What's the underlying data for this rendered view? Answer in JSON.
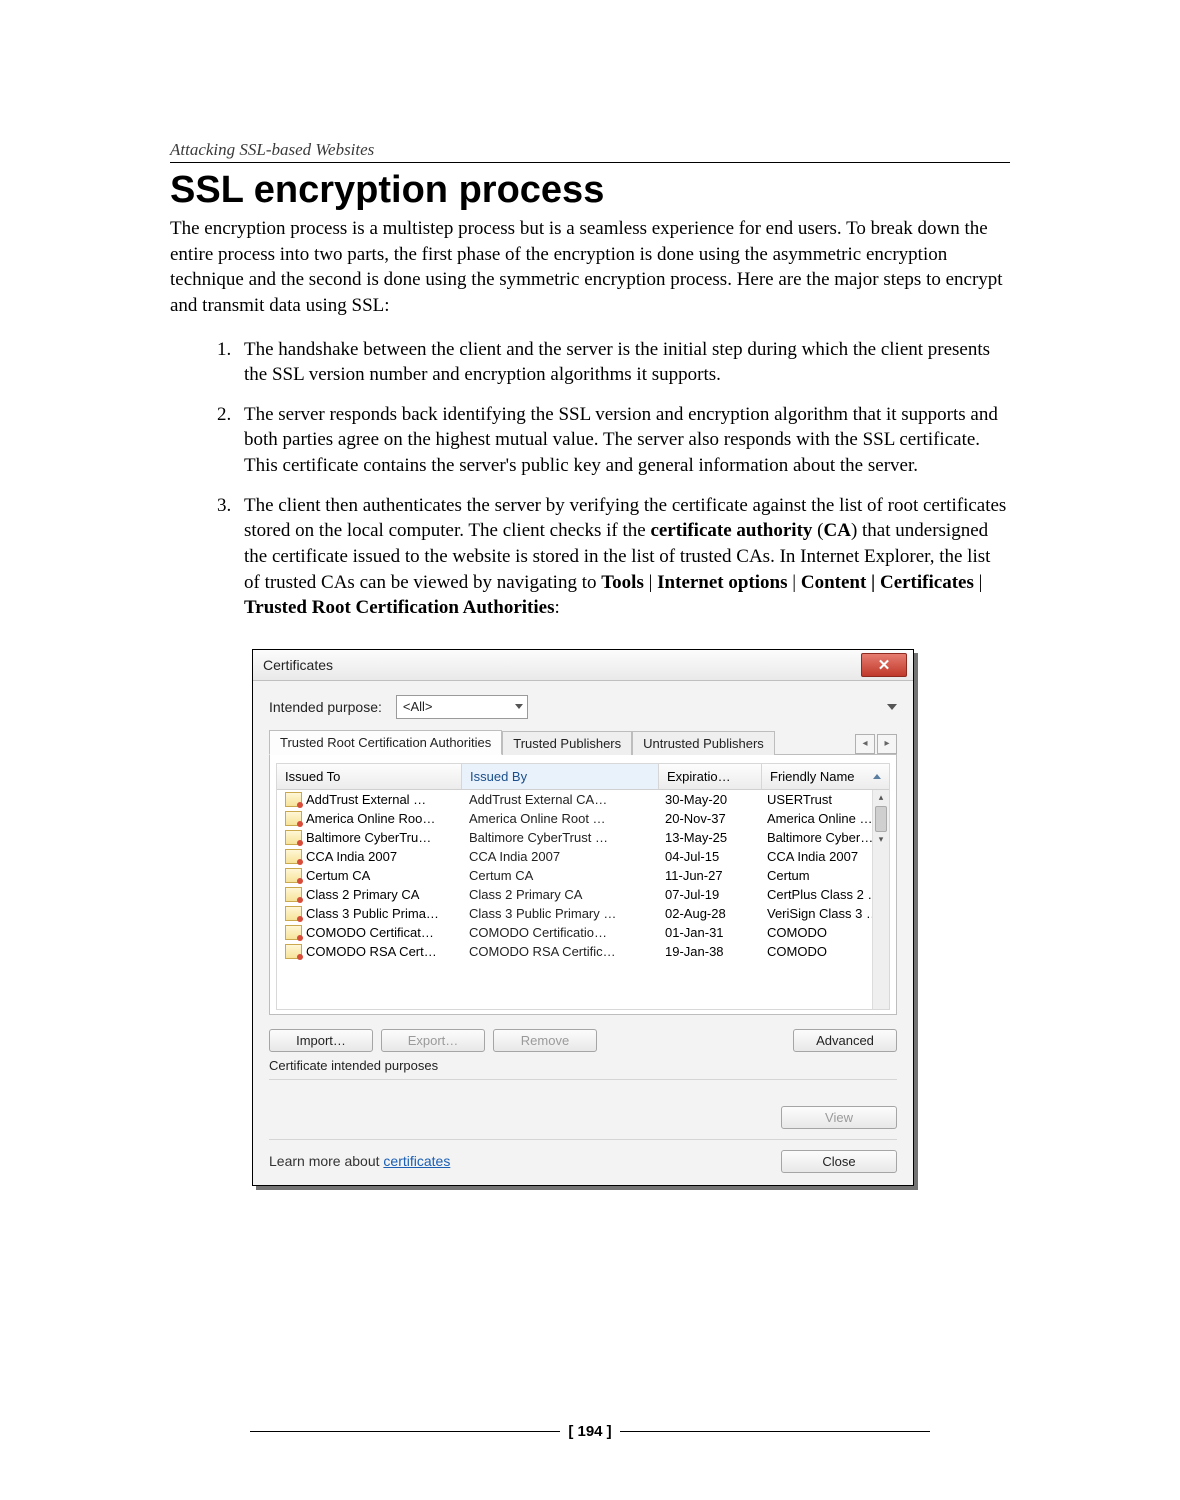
{
  "page": {
    "running_head": "Attacking SSL-based Websites",
    "title": "SSL encryption process",
    "intro": "The encryption process is a multistep process but is a seamless experience for end users. To break down the entire process into two parts, the first phase of the encryption is done using the asymmetric encryption technique and the second is done using the symmetric encryption process. Here are the major steps to encrypt and transmit data using SSL:",
    "steps": {
      "s1": "The handshake between the client and the server is the initial step during which the client presents the SSL version number and encryption algorithms it supports.",
      "s2": "The server responds back identifying the SSL version and encryption algorithm that it supports and both parties agree on the highest mutual value. The server also responds with the SSL certificate. This certificate contains the server's public key and general information about the server.",
      "s3_a": "The client then authenticates the server by verifying the certificate against the list of root certificates stored on the local computer. The client checks if the ",
      "s3_bold1": "certificate authority",
      "s3_mid1": " (",
      "s3_bold2": "CA",
      "s3_mid2": ") that undersigned the certificate issued to the website is stored in the list of trusted CAs. In Internet Explorer, the list of trusted CAs can be viewed by navigating to ",
      "s3_bold3": "Tools",
      "s3_sep1": " | ",
      "s3_bold4": "Internet options",
      "s3_sep2": " | ",
      "s3_bold5": "Content | Certificates",
      "s3_sep3": " | ",
      "s3_bold6": "Trusted Root Certification Authorities",
      "s3_end": ":"
    },
    "page_number": "[ 194 ]"
  },
  "dialog": {
    "title": "Certificates",
    "close_glyph": "✕",
    "purpose_label": "Intended purpose:",
    "purpose_value": "<All>",
    "tabs": {
      "t0": "Trusted Root Certification Authorities",
      "t1": "Trusted Publishers",
      "t2": "Untrusted Publishers",
      "scroll_left": "◂",
      "scroll_right": "▸"
    },
    "columns": {
      "c0": "Issued To",
      "c1": "Issued By",
      "c2": "Expiratio…",
      "c3": "Friendly Name"
    },
    "rows": [
      {
        "to": "AddTrust External …",
        "by": "AddTrust External CA…",
        "exp": "30-May-20",
        "fn": "USERTrust"
      },
      {
        "to": "America Online Roo…",
        "by": "America Online Root …",
        "exp": "20-Nov-37",
        "fn": "America Online R…"
      },
      {
        "to": "Baltimore CyberTru…",
        "by": "Baltimore CyberTrust …",
        "exp": "13-May-25",
        "fn": "Baltimore Cyber…"
      },
      {
        "to": "CCA India 2007",
        "by": "CCA India 2007",
        "exp": "04-Jul-15",
        "fn": "CCA India 2007"
      },
      {
        "to": "Certum CA",
        "by": "Certum CA",
        "exp": "11-Jun-27",
        "fn": "Certum"
      },
      {
        "to": "Class 2 Primary CA",
        "by": "Class 2 Primary CA",
        "exp": "07-Jul-19",
        "fn": "CertPlus Class 2 …"
      },
      {
        "to": "Class 3 Public Prima…",
        "by": "Class 3 Public Primary …",
        "exp": "02-Aug-28",
        "fn": "VeriSign Class 3 …"
      },
      {
        "to": "COMODO Certificat…",
        "by": "COMODO Certificatio…",
        "exp": "01-Jan-31",
        "fn": "COMODO"
      },
      {
        "to": "COMODO RSA Cert…",
        "by": "COMODO RSA Certific…",
        "exp": "19-Jan-38",
        "fn": "COMODO"
      }
    ],
    "buttons": {
      "import": "Import…",
      "export": "Export…",
      "remove": "Remove",
      "advanced": "Advanced",
      "view": "View",
      "close": "Close"
    },
    "intended_purposes_label": "Certificate intended purposes",
    "learn_prefix": "Learn more about ",
    "learn_link": "certificates",
    "scroll_up": "▴",
    "scroll_down": "▾"
  }
}
